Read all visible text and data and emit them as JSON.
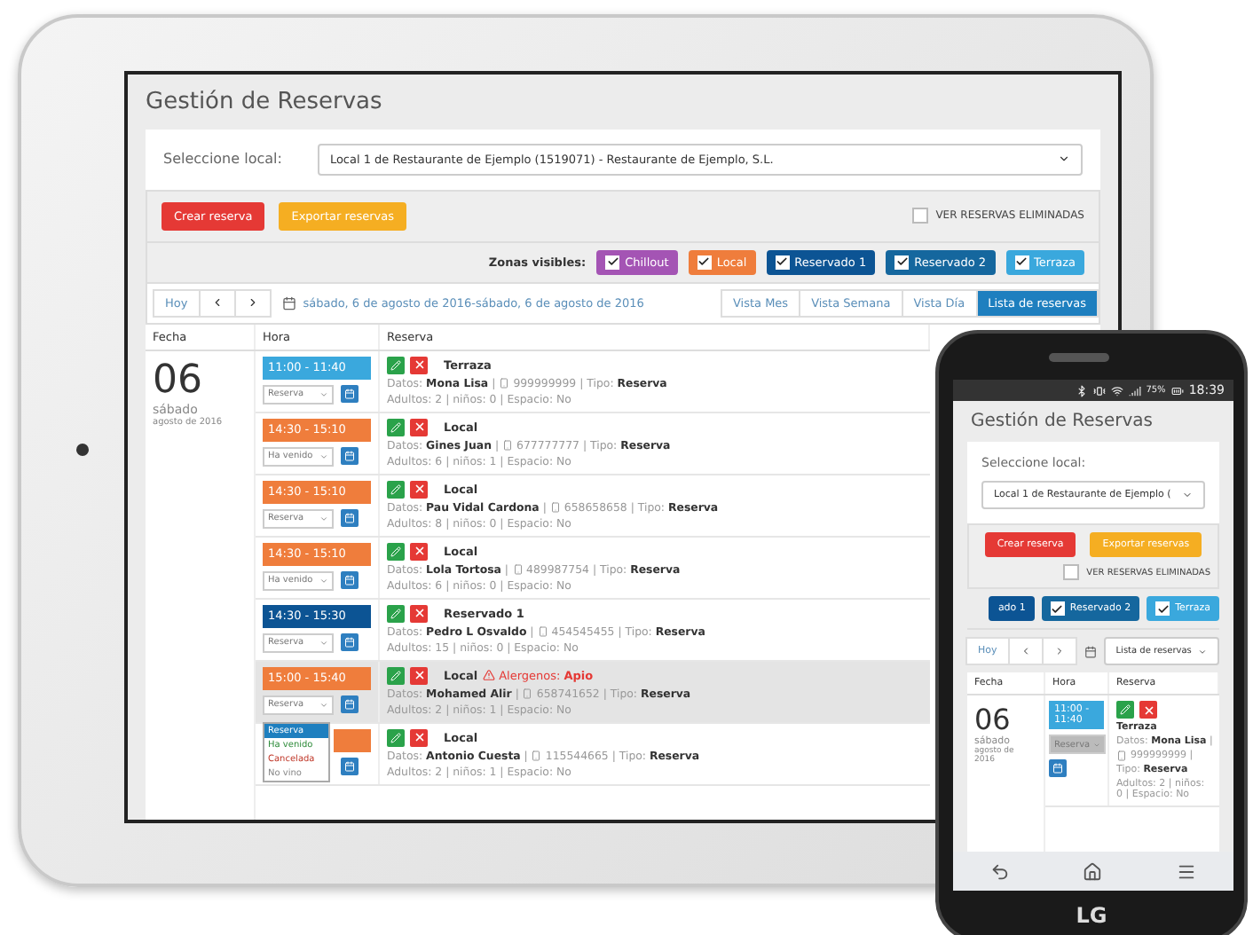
{
  "tablet": {
    "title": "Gestión de Reservas",
    "select_label": "Seleccione local:",
    "select_value": "Local 1 de Restaurante de Ejemplo (1519071) - Restaurante de Ejemplo, S.L.",
    "buttons": [
      {
        "label": "Crear reserva",
        "kind": "danger"
      },
      {
        "label": "Exportar reservas",
        "kind": "warning"
      }
    ],
    "show_deleted": {
      "label": "VER RESERVAS ELIMINADAS",
      "checked": false
    },
    "zones_label": "Zonas visibles:",
    "zones": [
      {
        "label": "Chillout",
        "checked": true,
        "color": "#a454b4"
      },
      {
        "label": "Local",
        "checked": true,
        "color": "#ef7d3c"
      },
      {
        "label": "Reservado 1",
        "checked": true,
        "color": "#0c5494"
      },
      {
        "label": "Reservado 2",
        "checked": true,
        "color": "#15679e"
      },
      {
        "label": "Terraza",
        "checked": true,
        "color": "#3aa8dd"
      }
    ],
    "today": "Hoy",
    "date_range": "sábado, 6 de agosto de 2016-sábado, 6 de agosto de 2016",
    "views": [
      {
        "label": "Vista Mes",
        "selected": false
      },
      {
        "label": "Vista Semana",
        "selected": false
      },
      {
        "label": "Vista Día",
        "selected": false
      },
      {
        "label": "Lista de reservas",
        "selected": true
      }
    ],
    "columns": [
      "Fecha",
      "Hora",
      "Reserva"
    ],
    "day": "06",
    "weekday": "sábado",
    "month": "agosto de 2016",
    "rows": [
      {
        "time": "11:00 - 11:40",
        "color": "#3aa8dd",
        "status": "Reserva",
        "zone": "Terraza",
        "contact": "Datos: **Mona Lisa** |",
        "phone": "999999999",
        "type": "| Tipo: **Reserva**",
        "details": "Adultos: 2 | niños: 0 | Espacio: No",
        "selected": false
      },
      {
        "time": "14:30 - 15:10",
        "color": "#ef7d3c",
        "status": "Ha venido",
        "zone": "Local",
        "contact": "Datos: **Gines Juan** |",
        "phone": "677777777",
        "type": "| Tipo: **Reserva**",
        "details": "Adultos: 6 | niños: 1 | Espacio: No",
        "selected": false
      },
      {
        "time": "14:30 - 15:10",
        "color": "#ef7d3c",
        "status": "Reserva",
        "zone": "Local",
        "contact": "Datos: **Pau Vidal Cardona** |",
        "phone": "658658658",
        "type": "| Tipo: **Reserva**",
        "details": "Adultos: 8 | niños: 0 | Espacio: No",
        "selected": false
      },
      {
        "time": "14:30 - 15:10",
        "color": "#ef7d3c",
        "status": "Ha venido",
        "zone": "Local",
        "contact": "Datos: **Lola Tortosa** |",
        "phone": "489987754",
        "type": "| Tipo: **Reserva**",
        "details": "Adultos: 6 | niños: 0 | Espacio: No",
        "selected": false
      },
      {
        "time": "14:30 - 15:30",
        "color": "#0c5494",
        "status": "Reserva",
        "zone": "Reservado 1",
        "contact": "Datos: **Pedro L Osvaldo** |",
        "phone": "454545455",
        "type": "| Tipo: **Reserva**",
        "details": "Adultos: 15 | niños: 0 | Espacio: No",
        "selected": false
      },
      {
        "time": "15:00 - 15:40",
        "color": "#ef7d3c",
        "status": "Reserva",
        "zone": "Local",
        "allergen_label": "Alergenos:",
        "allergen": "Apio",
        "contact": "Datos: **Mohamed Alir** |",
        "phone": "658741652",
        "type": "| Tipo: **Reserva**",
        "details": "Adultos: 2 | niños: 1 | Espacio: No",
        "selected": true,
        "options": [
          {
            "label": "Reserva",
            "selected": true,
            "kind": "booked"
          },
          {
            "label": "Ha venido",
            "selected": false,
            "kind": "arrived"
          },
          {
            "label": "Cancelada",
            "selected": false,
            "kind": "cancelled"
          },
          {
            "label": "No vino",
            "selected": false,
            "kind": "noshow"
          }
        ]
      },
      {
        "color": "#ef7d3c",
        "zone": "Local",
        "contact": "Datos: **Antonio Cuesta** |",
        "phone": "115544665",
        "type": "| Tipo: **Reserva**",
        "details": "Adultos: 2 | niños: 1 | Espacio: No",
        "selected": false
      }
    ]
  },
  "phone": {
    "battery": "75%",
    "clock": "18:39",
    "title": "Gestión de Reservas",
    "select_label": "Seleccione local:",
    "select_value": "Local 1 de Restaurante de Ejemplo (",
    "buttons": [
      {
        "label": "Crear reserva",
        "kind": "danger"
      },
      {
        "label": "Exportar reservas",
        "kind": "warning"
      }
    ],
    "show_deleted": {
      "label": "VER RESERVAS ELIMINADAS",
      "checked": false
    },
    "zones": [
      {
        "label": "ado 1",
        "color": "#0c5494"
      },
      {
        "label": "Reservado 2",
        "checked": true,
        "color": "#15679e"
      },
      {
        "label": "Terraza",
        "checked": true,
        "color": "#3aa8dd"
      }
    ],
    "today": "Hoy",
    "view_select": "Lista de reservas",
    "columns": [
      "Fecha",
      "Hora",
      "Reserva"
    ],
    "day": "06",
    "weekday": "sábado",
    "month": "agosto de 2016",
    "row": {
      "time": "11:00 - 11:40",
      "color": "#3aa8dd",
      "status": "Reserva",
      "zone": "Terraza",
      "contact": "Datos: **Mona Lisa** |",
      "phone": "999999999 |",
      "type": "Tipo: **Reserva**",
      "details": "Adultos: 2 | niños: 0 | Espacio: No"
    },
    "brand": "LG"
  }
}
